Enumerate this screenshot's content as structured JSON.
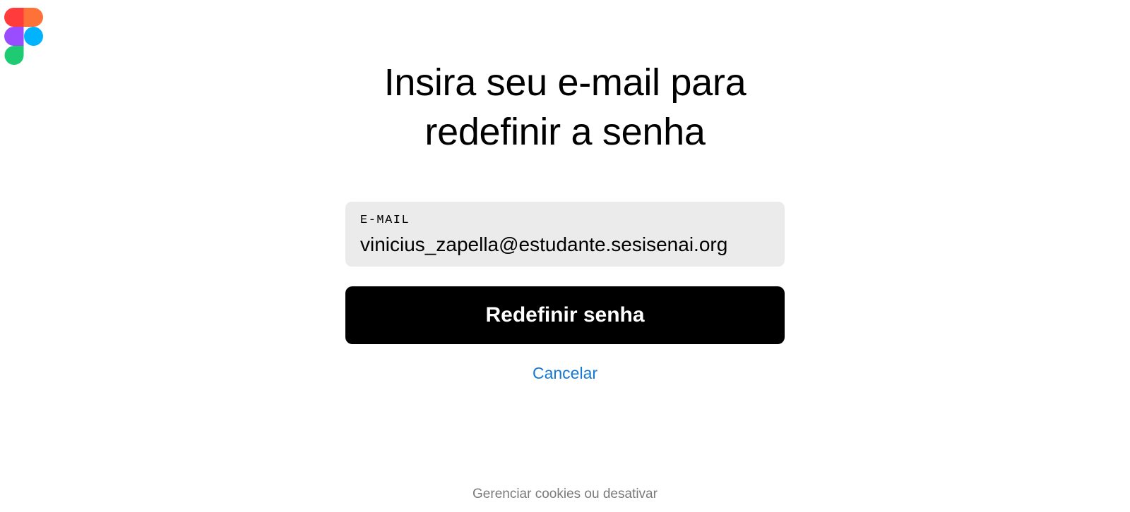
{
  "brand": {
    "logo_icon": "figma-logo-icon",
    "colors": {
      "red": "#f24e1e",
      "orange": "#ff7262",
      "purple": "#a259ff",
      "blue": "#1abcfe",
      "green": "#0acf83"
    }
  },
  "form": {
    "title": "Insira seu e-mail para redefinir a senha",
    "email_label": "E-MAIL",
    "email_value": "vinicius_zapella@estudante.sesisenai.org",
    "submit_label": "Redefinir senha",
    "cancel_label": "Cancelar"
  },
  "footer": {
    "cookies_label": "Gerenciar cookies ou desativar"
  },
  "theme": {
    "accent": "#1479d6",
    "button_bg": "#000000",
    "field_bg": "#ebebeb",
    "muted_text": "#7a7a7a"
  }
}
